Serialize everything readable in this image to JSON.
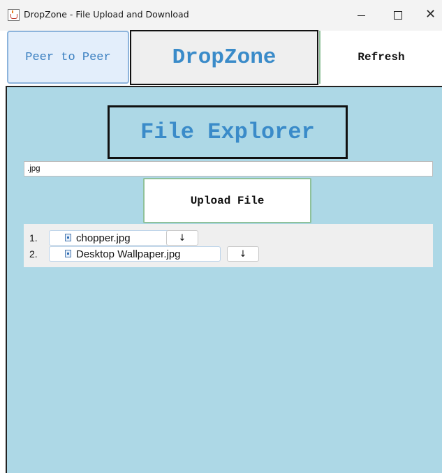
{
  "window": {
    "title": "DropZone - File Upload and Download",
    "minimize_glyph": "",
    "maximize_glyph": "",
    "close_glyph": "✕"
  },
  "toolbar": {
    "peer_label": "Peer to Peer",
    "brand": "DropZone",
    "refresh_label": "Refresh"
  },
  "explorer": {
    "title": "File Explorer",
    "filter_value": ".jpg",
    "upload_label": "Upload File"
  },
  "files": [
    {
      "index": "1.",
      "name": "chopper.jpg",
      "download_glyph": "↓"
    },
    {
      "index": "2.",
      "name": "Desktop Wallpaper.jpg",
      "download_glyph": "↓"
    }
  ],
  "colors": {
    "panel_bg": "#add8e6",
    "accent_blue": "#3a8bc9",
    "green_border": "#8fc19a"
  }
}
